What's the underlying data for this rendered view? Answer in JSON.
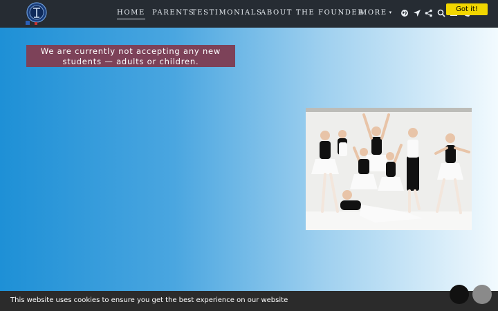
{
  "nav": {
    "items": [
      {
        "label": "Home",
        "active": true
      },
      {
        "label": "Parents",
        "active": false
      },
      {
        "label": "Testimonials",
        "active": false
      },
      {
        "label": "About the Founder",
        "active": false
      },
      {
        "label": "More",
        "active": false
      }
    ],
    "more_caret": "▾",
    "icons": [
      "globe-icon",
      "location-arrow-icon",
      "share-icon",
      "search-icon",
      "envelope-icon",
      "phone-icon"
    ]
  },
  "notice": {
    "text": "We are currently not accepting any new students — adults or children."
  },
  "photo": {
    "subject": "group of young ballet students in black leotards and white skirts"
  },
  "cookie": {
    "message": "This website uses cookies to ensure you get the best experience on our website",
    "button": "Got it!"
  },
  "colors": {
    "header_bg": "#262c33",
    "notice_bg": "#7d4259",
    "cookie_bg": "#2b2b2b",
    "cookie_button": "#f1d600",
    "gradient_start": "#1e90d6",
    "gradient_end": "#f2fafe"
  }
}
